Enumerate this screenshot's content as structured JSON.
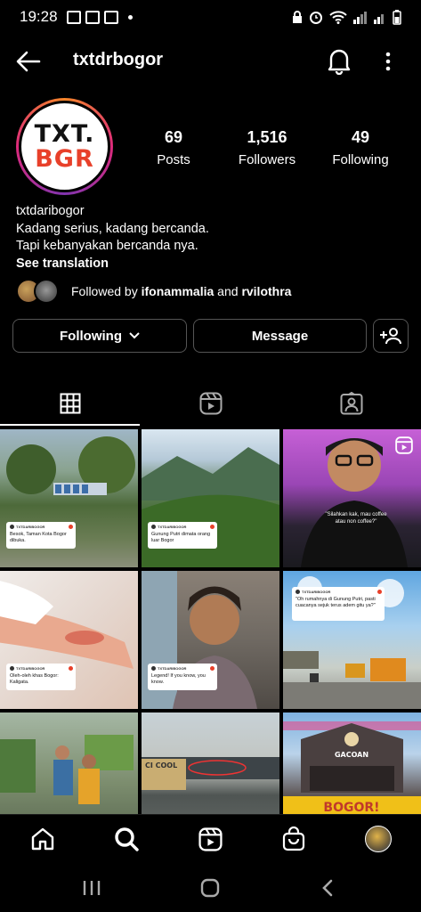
{
  "status_bar": {
    "time": "19:28"
  },
  "header": {
    "username": "txtdrbogor"
  },
  "profile": {
    "logo_line1": "TXT.",
    "logo_line2": "BGR",
    "stats": [
      {
        "value": "69",
        "label": "Posts"
      },
      {
        "value": "1,516",
        "label": "Followers"
      },
      {
        "value": "49",
        "label": "Following"
      }
    ],
    "name": "txtdaribogor",
    "bio_line1": "Kadang serius, kadang bercanda.",
    "bio_line2": "Tapi kebanyakan bercanda nya.",
    "see_translation": "See translation",
    "followed_prefix": "Followed by ",
    "followed_user1": "ifonammalia",
    "followed_and": " and ",
    "followed_user2": "rvilothra"
  },
  "buttons": {
    "following": "Following",
    "message": "Message"
  },
  "posts": [
    {
      "text": "Besok, Taman Kota Bogor dibuka."
    },
    {
      "text": "Gunung Putri dimata orang luar Bogor"
    },
    {
      "text": "\"Silahkan kak, mau coffee atau non coffee?\""
    },
    {
      "text": "Oleh-oleh khas Bogor: Kaligata."
    },
    {
      "text": "Legend! If you know, you know."
    },
    {
      "text": "\"Oh rumahnya di Gunung Putri, pasti cuacanya sejuk terus adem gitu ya?\""
    }
  ],
  "post_header": "TXTDARIBOGOR",
  "sign_texts": {
    "gacoan": "GACOAN",
    "bogor": "BOGOR!",
    "cool": "CI COOL"
  },
  "colors": {
    "accent": "#e8402a",
    "background": "#000000"
  }
}
